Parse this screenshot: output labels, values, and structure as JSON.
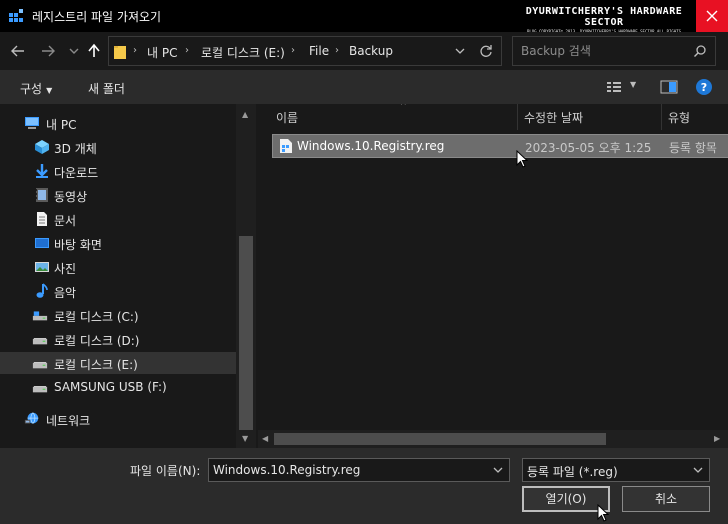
{
  "window": {
    "title": "레지스트리 파일 가져오기",
    "watermark_main": "DYURWITCHERRY'S HARDWARE SECTOR",
    "watermark_sub": "BLOG COPYRIGHT© 2013. DYURWITCHERRY'S HARDWARE SECTOR ALL RIGHTS RESERVED."
  },
  "navigation": {
    "breadcrumb": [
      "내 PC",
      "로컬 디스크 (E:)",
      "File",
      "Backup"
    ],
    "search_placeholder": "Backup 검색"
  },
  "toolbar": {
    "organize_label": "구성",
    "new_folder_label": "새 폴더"
  },
  "sidebar": {
    "items": [
      {
        "label": "내 PC",
        "icon": "pc-icon"
      },
      {
        "label": "3D 개체",
        "icon": "3d-objects-icon"
      },
      {
        "label": "다운로드",
        "icon": "download-icon"
      },
      {
        "label": "동영상",
        "icon": "video-icon"
      },
      {
        "label": "문서",
        "icon": "document-icon"
      },
      {
        "label": "바탕 화면",
        "icon": "desktop-icon"
      },
      {
        "label": "사진",
        "icon": "pictures-icon"
      },
      {
        "label": "음악",
        "icon": "music-icon"
      },
      {
        "label": "로컬 디스크 (C:)",
        "icon": "drive-icon"
      },
      {
        "label": "로컬 디스크 (D:)",
        "icon": "drive-icon"
      },
      {
        "label": "로컬 디스크 (E:)",
        "icon": "drive-icon",
        "selected": true
      },
      {
        "label": "SAMSUNG USB (F:)",
        "icon": "usb-drive-icon"
      },
      {
        "label": "네트워크",
        "icon": "network-icon"
      }
    ]
  },
  "file_list": {
    "columns": [
      "이름",
      "수정한 날짜",
      "유형"
    ],
    "rows": [
      {
        "name": "Windows.10.Registry.reg",
        "modified": "2023-05-05 오후 1:25",
        "type": "등록 항목",
        "selected": true
      }
    ]
  },
  "footer": {
    "filename_label": "파일 이름(N):",
    "filename_value": "Windows.10.Registry.reg",
    "filetype_value": "등록 파일 (*.reg)",
    "open_label": "열기(O)",
    "cancel_label": "취소"
  },
  "colors": {
    "accent_close": "#e81123",
    "help_blue": "#1e78d7",
    "folder_yellow": "#f5c94a"
  }
}
